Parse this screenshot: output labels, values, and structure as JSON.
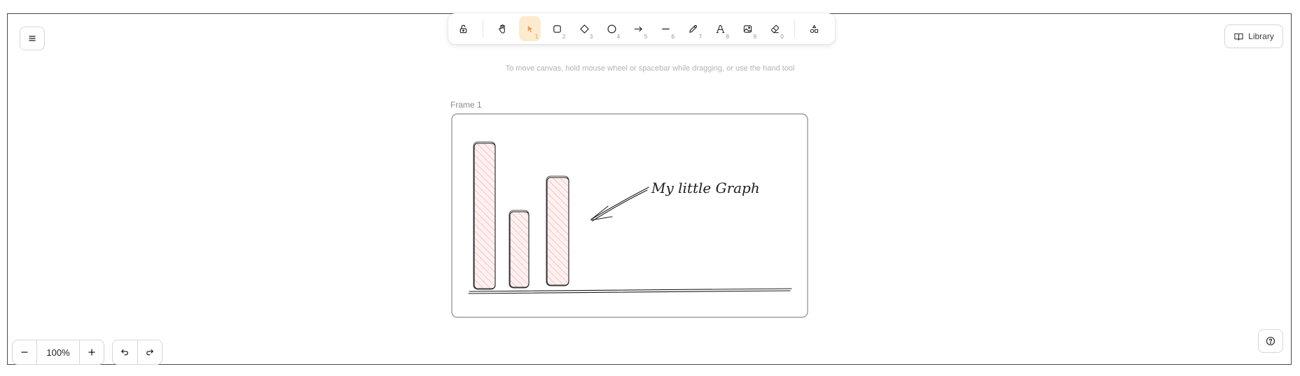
{
  "toolbar": {
    "tools": [
      {
        "name": "lock",
        "icon": "lock-icon",
        "key": ""
      },
      {
        "name": "hand",
        "icon": "hand-icon",
        "key": ""
      },
      {
        "name": "selection",
        "icon": "pointer-icon",
        "key": "1",
        "active": true
      },
      {
        "name": "rectangle",
        "icon": "square-icon",
        "key": "2"
      },
      {
        "name": "diamond",
        "icon": "diamond-icon",
        "key": "3"
      },
      {
        "name": "ellipse",
        "icon": "circle-icon",
        "key": "4"
      },
      {
        "name": "arrow",
        "icon": "arrow-right-icon",
        "key": "5"
      },
      {
        "name": "line",
        "icon": "line-icon",
        "key": "6"
      },
      {
        "name": "draw",
        "icon": "pencil-icon",
        "key": "7"
      },
      {
        "name": "text",
        "icon": "text-icon",
        "key": "8"
      },
      {
        "name": "image",
        "icon": "image-icon",
        "key": "9"
      },
      {
        "name": "eraser",
        "icon": "eraser-icon",
        "key": "0"
      },
      {
        "name": "more-shapes",
        "icon": "shapes-icon",
        "key": ""
      }
    ],
    "active_color": "#fdebd0"
  },
  "hint": "To move canvas, hold mouse wheel or spacebar while dragging, or use the hand tool",
  "library": {
    "label": "Library"
  },
  "canvas": {
    "frame_label": "Frame 1",
    "annotation_text": "My little Graph",
    "bar_count": 3,
    "bar_fill_color": "#f4a7a7"
  },
  "zoom": {
    "level": "100%"
  },
  "icons": {
    "menu": "hamburger-icon",
    "help": "question-circle-icon",
    "undo": "undo-icon",
    "redo": "redo-icon",
    "zoom_in": "plus-icon",
    "zoom_out": "minus-icon"
  }
}
